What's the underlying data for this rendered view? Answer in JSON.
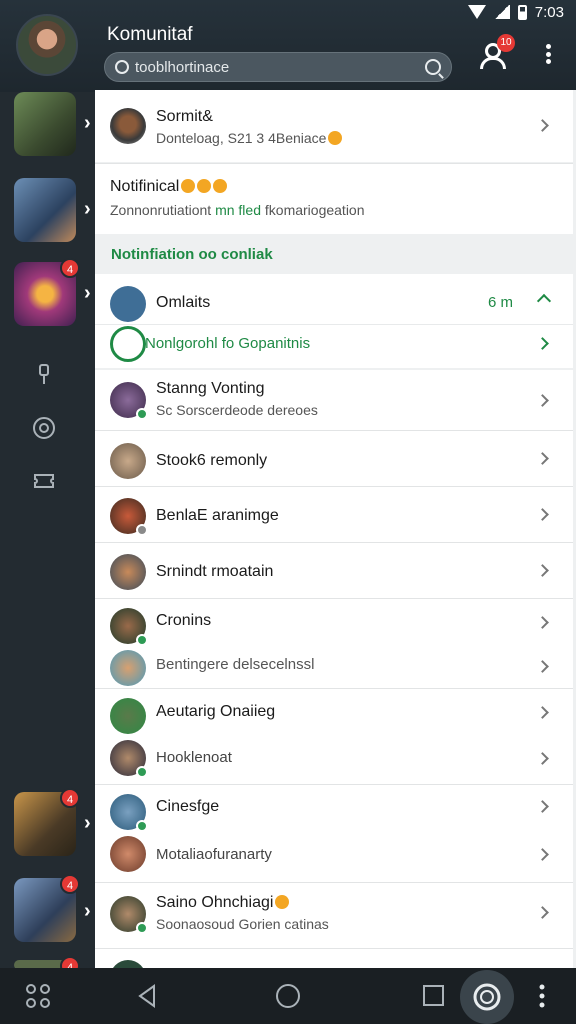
{
  "status_bar": {
    "time": "7:03",
    "icons": [
      "wifi-icon",
      "signal-icon",
      "battery-icon"
    ]
  },
  "header": {
    "title": "Komunitaf",
    "search_value": "tooblhortinace",
    "notification_badge": "10"
  },
  "sidebar": {
    "badges": [
      "4",
      "4",
      "4",
      "4"
    ]
  },
  "top_cards": [
    {
      "title": "Sormit&",
      "subtitle": "Donteloag, S21 3  4Beniace"
    },
    {
      "title": "Notifinical",
      "subtitle_a": "Zonnonrutiationt",
      "subtitle_b": "mn",
      "subtitle_c": "fled",
      "subtitle_d": "fkomariogeation"
    }
  ],
  "section": {
    "label": "Notinfiation oo conliak"
  },
  "group": {
    "title": "Omlaits",
    "time": "6 m",
    "action": "Nonlgorohl fo Gopanitnis"
  },
  "list": [
    {
      "title": "Stanng Vonting",
      "subtitle": "Sc Sorscerdeode dereoes"
    },
    {
      "title": "Stook6 remonly",
      "subtitle": ""
    },
    {
      "title": "BenlaE aranimge",
      "subtitle": ""
    },
    {
      "title": "Srnindt rmoatain",
      "subtitle": ""
    },
    {
      "title": "Cronins",
      "subtitle": ""
    },
    {
      "title": "Bentingere delsecelnssl",
      "subtitle": ""
    },
    {
      "title": "Aeutarig Onaiieg",
      "subtitle": ""
    },
    {
      "title": "Hooklenoat",
      "subtitle": ""
    },
    {
      "title": "Cinesfge",
      "subtitle": ""
    },
    {
      "title": "Motaliaofuranarty",
      "subtitle": ""
    },
    {
      "title": "Saino Ohnchiagi",
      "subtitle": "Soonaosoud Gorien catinas"
    }
  ],
  "colors": {
    "accent_green": "#1f8a45",
    "badge_red": "#e53935",
    "header_bg": "#26323b"
  }
}
